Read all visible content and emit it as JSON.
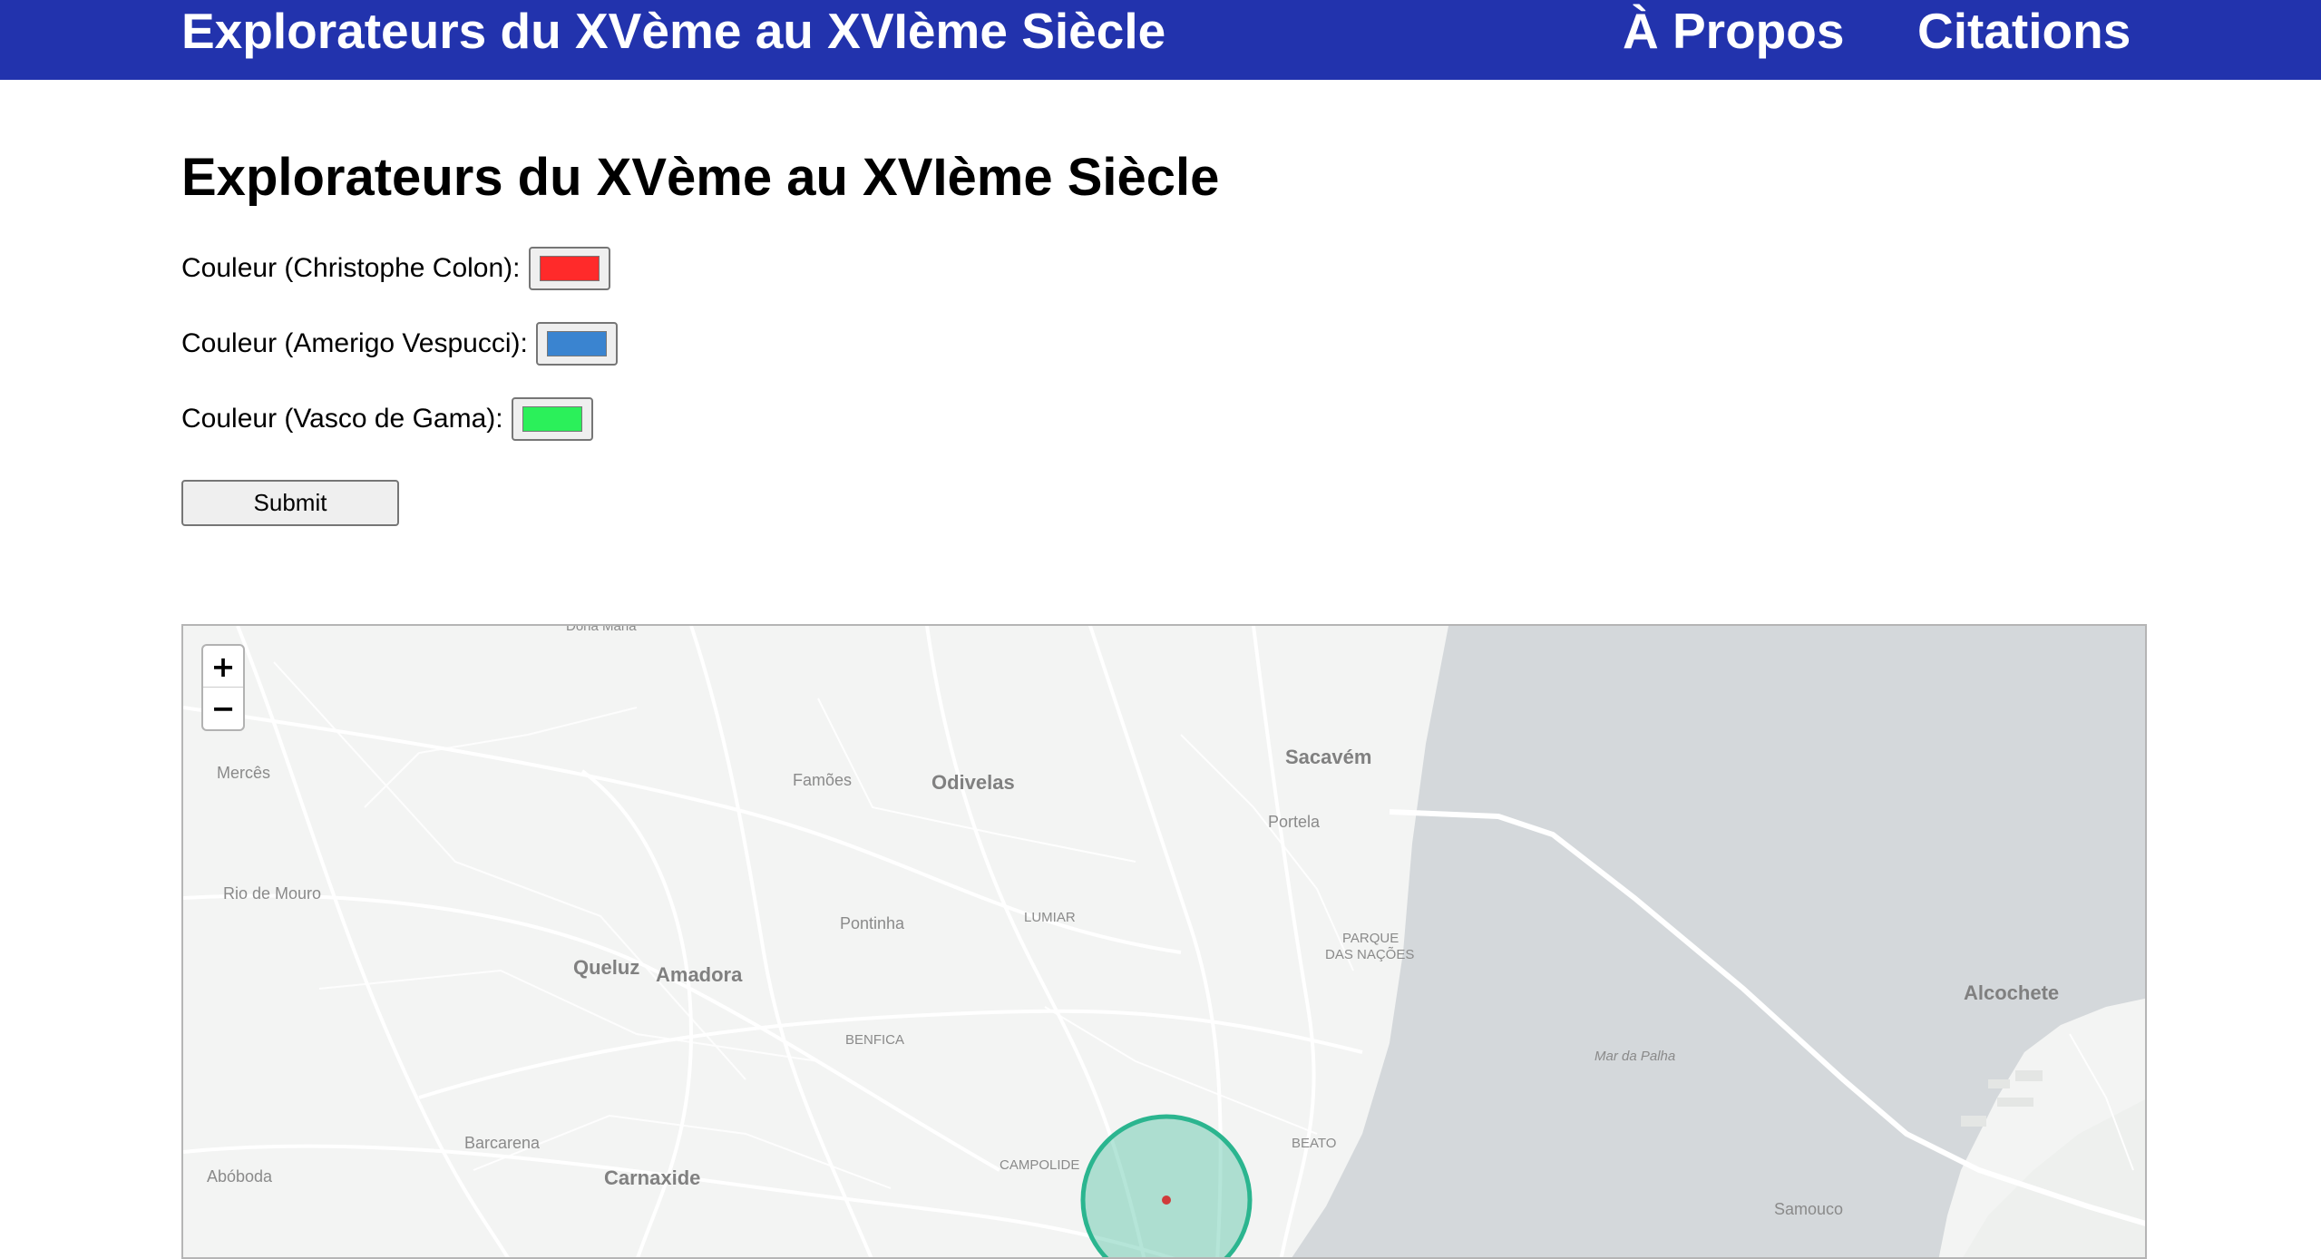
{
  "header": {
    "brand": "Explorateurs du XVème au XVIème Siècle",
    "nav": [
      "À Propos",
      "Citations"
    ]
  },
  "main": {
    "title": "Explorateurs du XVème au XVIème Siècle",
    "fields": [
      {
        "label": "Couleur (Christophe Colon):",
        "color": "#ff2a2a"
      },
      {
        "label": "Couleur (Amerigo Vespucci):",
        "color": "#3a84d0"
      },
      {
        "label": "Couleur (Vasco de Gama):",
        "color": "#2bf05a"
      }
    ],
    "submit_label": "Submit"
  },
  "map": {
    "zoom_in": "+",
    "zoom_out": "−",
    "labels": {
      "bona": "Dona Maria",
      "merces": "Mercês",
      "famoes": "Famões",
      "odivelas": "Odivelas",
      "sacavem": "Sacavém",
      "portela": "Portela",
      "riodemouro": "Rio de Mouro",
      "pontinha": "Pontinha",
      "lumiar": "LUMIAR",
      "parque1": "PARQUE",
      "parque2": "DAS NAÇÕES",
      "queluz": "Queluz",
      "amadora": "Amadora",
      "alcochete": "Alcochete",
      "benfica": "BENFICA",
      "mardapalha": "Mar da Palha",
      "barcarena": "Barcarena",
      "beato": "BEATO",
      "aboboda": "Abóboda",
      "carnaxide": "Carnaxide",
      "campolide": "CAMPOLIDE",
      "samouco": "Samouco"
    },
    "colors": {
      "water": "#d4d8db",
      "land": "#f3f4f3",
      "road": "#ffffff",
      "circle": "#2bb58f",
      "marker": "#d03b3b"
    }
  }
}
